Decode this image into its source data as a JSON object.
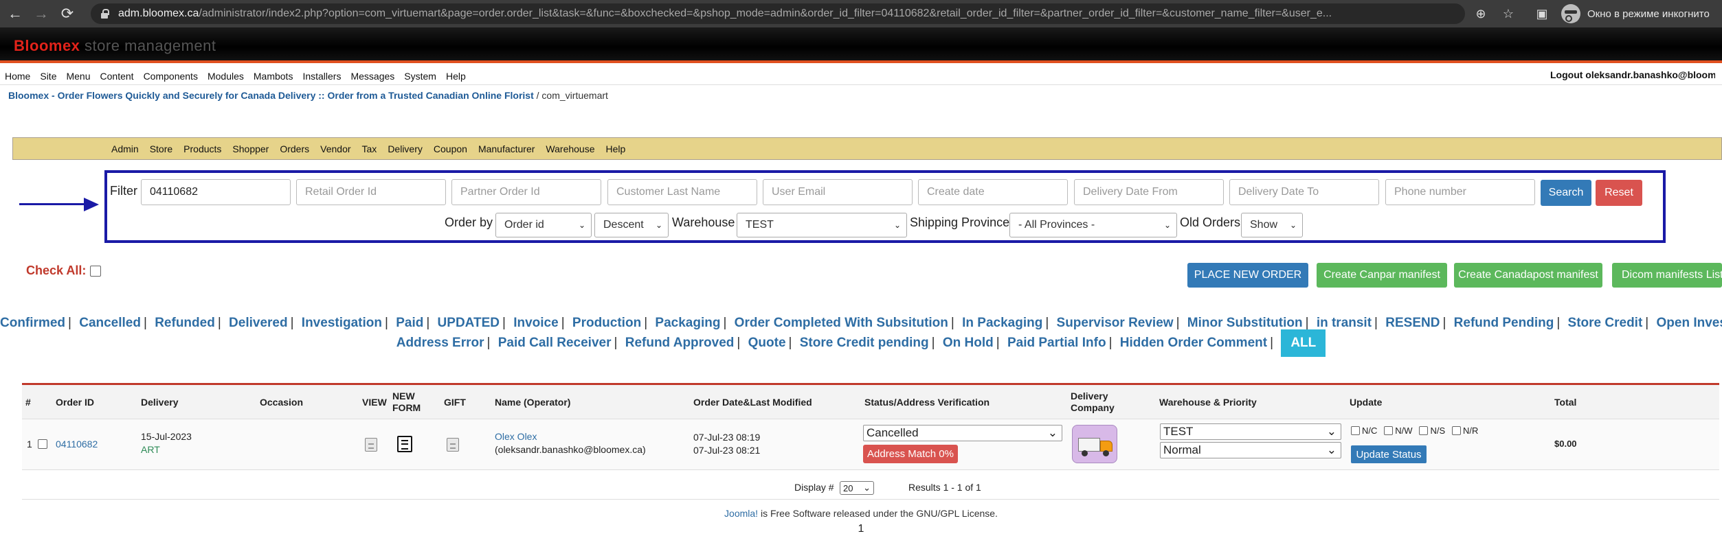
{
  "browser": {
    "url_domain": "adm.bloomex.ca",
    "url_path": "/administrator/index2.php?option=com_virtuemart&page=order.order_list&task=&func=&boxchecked=&pshop_mode=admin&order_id_filter=04110682&retail_order_id_filter=&partner_order_id_filter=&customer_name_filter=&user_e...",
    "incognito_label": "Окно в режиме инкогнито"
  },
  "header": {
    "brand": "Bloomex",
    "subtitle": "store management"
  },
  "top_menu": [
    "Home",
    "Site",
    "Menu",
    "Content",
    "Components",
    "Modules",
    "Mambots",
    "Installers",
    "Messages",
    "System",
    "Help"
  ],
  "logout_text": "Logout oleksandr.banashko@bloomex.ca",
  "breadcrumb": {
    "site": "Bloomex - Order Flowers Quickly and Securely for Canada Delivery :: Order from a Trusted Canadian Online Florist",
    "component": " / com_virtuemart"
  },
  "vm_menu": [
    "Admin",
    "Store",
    "Products",
    "Shopper",
    "Orders",
    "Vendor",
    "Tax",
    "Delivery",
    "Coupon",
    "Manufacturer",
    "Warehouse",
    "Help"
  ],
  "filter": {
    "label": "Filter",
    "order_id_value": "04110682",
    "placeholders": {
      "retail": "Retail Order Id",
      "partner": "Partner Order Id",
      "lastname": "Customer Last Name",
      "email": "User Email",
      "create_date": "Create date",
      "delivery_from": "Delivery Date From",
      "delivery_to": "Delivery Date To",
      "phone": "Phone number"
    },
    "search_label": "Search",
    "reset_label": "Reset",
    "order_by_label": "Order by",
    "order_by_value": "Order id",
    "direction_value": "Descent",
    "warehouse_label": "Warehouse",
    "warehouse_value": "TEST",
    "province_label": "Shipping Province",
    "province_value": "- All Provinces -",
    "old_orders_label": "Old Orders",
    "old_orders_value": "Show"
  },
  "check_all_label": "Check All:",
  "actions": {
    "place_order": "PLACE NEW ORDER",
    "canpar": "Create Canpar manifest",
    "canadapost": "Create Canadapost manifest",
    "dicom": "Dicom manifests List"
  },
  "status_links_row1": [
    "Confirmed",
    "Cancelled",
    "Refunded",
    "Delivered",
    "Investigation",
    "Paid",
    "UPDATED",
    "Invoice",
    "Production",
    "Packaging",
    "Order Completed With Subsitution",
    "In Packaging",
    "Supervisor Review",
    "Minor Substitution",
    "in transit",
    "RESEND",
    "Refund Pending",
    "Store Credit",
    "Open Investigation"
  ],
  "status_links_row2": [
    "Address Error",
    "Paid Call Receiver",
    "Refund Approved",
    "Quote",
    "Store Credit pending",
    "On Hold",
    "Paid Partial Info",
    "Hidden Order Comment"
  ],
  "status_all": "ALL",
  "table": {
    "headers": {
      "num": "#",
      "order_id": "Order ID",
      "delivery": "Delivery",
      "occasion": "Occasion",
      "view": "VIEW",
      "new_form_1": "NEW",
      "new_form_2": "FORM",
      "gift": "GIFT",
      "name": "Name (Operator)",
      "order_date": "Order Date&Last Modified",
      "status": "Status/Address Verification",
      "delivery_company_1": "Delivery",
      "delivery_company_2": "Company",
      "warehouse": "Warehouse & Priority",
      "update": "Update",
      "total": "Total"
    },
    "row": {
      "num": "1",
      "order_id": "04110682",
      "delivery_date": "15-Jul-2023",
      "delivery_code": "ART",
      "name": "Olex Olex",
      "operator": "(oleksandr.banashko@bloomex.ca)",
      "order_date": "07-Jul-23 08:19",
      "modified_date": "07-Jul-23 08:21",
      "status_value": "Cancelled",
      "address_match": "Address Match 0%",
      "warehouse_value": "TEST",
      "priority_value": "Normal",
      "update_checks": [
        "N/C",
        "N/W",
        "N/S",
        "N/R"
      ],
      "update_button": "Update Status",
      "total": "$0.00"
    }
  },
  "pager": {
    "display_label": "Display #",
    "display_value": "20",
    "results": "Results 1 - 1 of 1"
  },
  "footer": {
    "link": "Joomla!",
    "text": " is Free Software released under the GNU/GPL License.",
    "page_num": "1"
  }
}
